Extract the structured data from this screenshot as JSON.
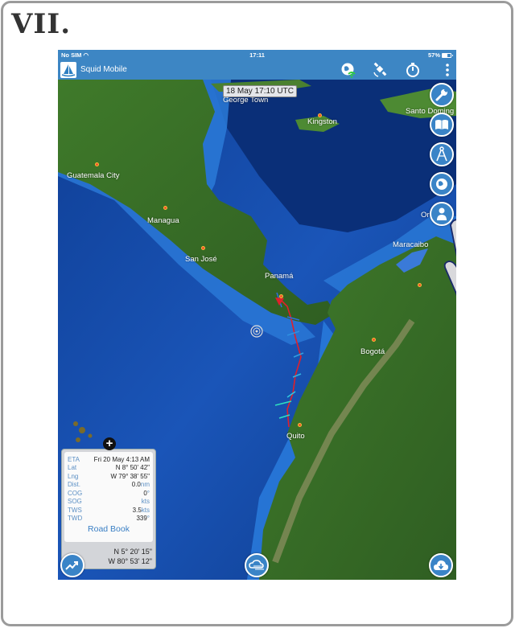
{
  "step_label": "VII.",
  "status_bar": {
    "carrier": "No SIM",
    "time": "17:11",
    "battery": "57%"
  },
  "app_bar": {
    "title": "Squid Mobile",
    "icons": [
      "globe-wifi-icon",
      "satellite-icon",
      "stopwatch-icon",
      "more-vertical-icon"
    ]
  },
  "map": {
    "time_badge": "18 May 17:10 UTC",
    "cities": [
      {
        "name": "George Town"
      },
      {
        "name": "Kingston"
      },
      {
        "name": "Santo Doming"
      },
      {
        "name": "Guatemala City"
      },
      {
        "name": "Managua"
      },
      {
        "name": "San José"
      },
      {
        "name": "Panamá"
      },
      {
        "name": "Maracaibo"
      },
      {
        "name": "Or"
      },
      {
        "name": "Bogotá"
      },
      {
        "name": "Quito"
      }
    ],
    "route_color": "#e0202a",
    "wind_barb_colors": [
      "#2f6fe0",
      "#2fb6e0",
      "#2fe0c0"
    ]
  },
  "right_toolbar": [
    {
      "name": "settings",
      "icon": "wrench-icon"
    },
    {
      "name": "logbook",
      "icon": "book-icon"
    },
    {
      "name": "routing",
      "icon": "compass-divider-icon"
    },
    {
      "name": "weather-layers",
      "icon": "globe-layers-icon"
    },
    {
      "name": "crew",
      "icon": "person-icon"
    }
  ],
  "info_panel": {
    "rows": [
      {
        "key": "ETA",
        "value": "Fri 20 May 4:13 AM",
        "unit": ""
      },
      {
        "key": "Lat",
        "value": "N 8° 50' 42\"",
        "unit": ""
      },
      {
        "key": "Lng",
        "value": "W 79° 38' 55\"",
        "unit": ""
      },
      {
        "key": "Dist.",
        "value": "0.0",
        "unit": "nm"
      },
      {
        "key": "COG",
        "value": "0",
        "unit": "°"
      },
      {
        "key": "SOG",
        "value": "",
        "unit": "kts"
      },
      {
        "key": "TWS",
        "value": "3.5",
        "unit": "kts"
      },
      {
        "key": "TWD",
        "value": "339",
        "unit": "°"
      }
    ],
    "road_book_label": "Road Book",
    "cursor_lat": "N 5° 20' 15\"",
    "cursor_lng": "W 80° 53' 12\""
  },
  "bottom_buttons": {
    "left": "chart-trend-icon",
    "center": "cloud-wind-icon",
    "right": "cloud-download-icon"
  }
}
